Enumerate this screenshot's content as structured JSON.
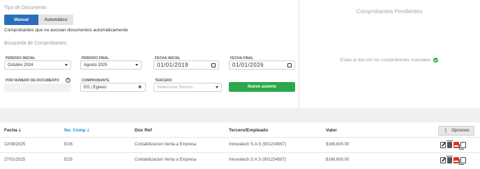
{
  "tipo": {
    "title": "Tipo de Documento",
    "manual": "Manual",
    "automatico": "Automático",
    "description": "Comprobantes que no asocian documentos automáticamente"
  },
  "busqueda": {
    "title": "Búsqueda de Comprobantes",
    "periodo_inicial": {
      "label": "PERIODO INICIAL",
      "value": "Octubre 2024"
    },
    "periodo_final": {
      "label": "PERIODO FINAL",
      "value": "Agosto 2025"
    },
    "fecha_inicial": {
      "label": "FECHA INICIAL",
      "value": "01/01/2019"
    },
    "fecha_final": {
      "label": "FECHA FINAL",
      "value": "01/01/2026"
    },
    "por_numero": {
      "label": "POR NUMERO DE DOCUMENTO",
      "help": "?"
    },
    "comprobante": {
      "label": "COMPROBANTE",
      "value": "EG | Egreso",
      "clear": "✖"
    },
    "tercero": {
      "label": "TERCERO",
      "placeholder": "Seleccione Tercero"
    },
    "nuevo_asiento": "Nuevo asiento"
  },
  "pendientes": {
    "title": "Comprobantes Pendientes",
    "message": "Estas al día con los comprobantes manuales"
  },
  "table": {
    "headers": {
      "fecha": "Fecha",
      "no_comp": "No. Comp",
      "doc_ref": "Doc Ref",
      "tercero": "Tercero/Empleado",
      "valor": "Valor",
      "sort_glyph": "⇣"
    },
    "options_label": "Opciones",
    "options_dots": "⋮",
    "rows": [
      {
        "fecha": "12/08/2025",
        "no_comp": "EG6",
        "doc_ref": "Contabilizacion Venta a Empresa",
        "tercero": "Innovatech S.A.S (901234567)",
        "valor": "$166,600.00"
      },
      {
        "fecha": "27/01/2025",
        "no_comp": "EG5",
        "doc_ref": "Contabilizacion Venta a Empresa",
        "tercero": "Innovatech S.A.S (901234567)",
        "valor": "$166,600.00"
      }
    ]
  },
  "colors": {
    "accent_blue": "#2a6ebb",
    "link_blue": "#1a8fd0",
    "success_green": "#2aa84a",
    "pdf_red": "#d9342b"
  },
  "icons": [
    "caret-down-icon",
    "calendar-icon",
    "clear-icon",
    "help-icon",
    "check-circle-icon",
    "sort-icon",
    "edit-icon",
    "trash-icon",
    "pdf-icon",
    "copy-icon"
  ]
}
